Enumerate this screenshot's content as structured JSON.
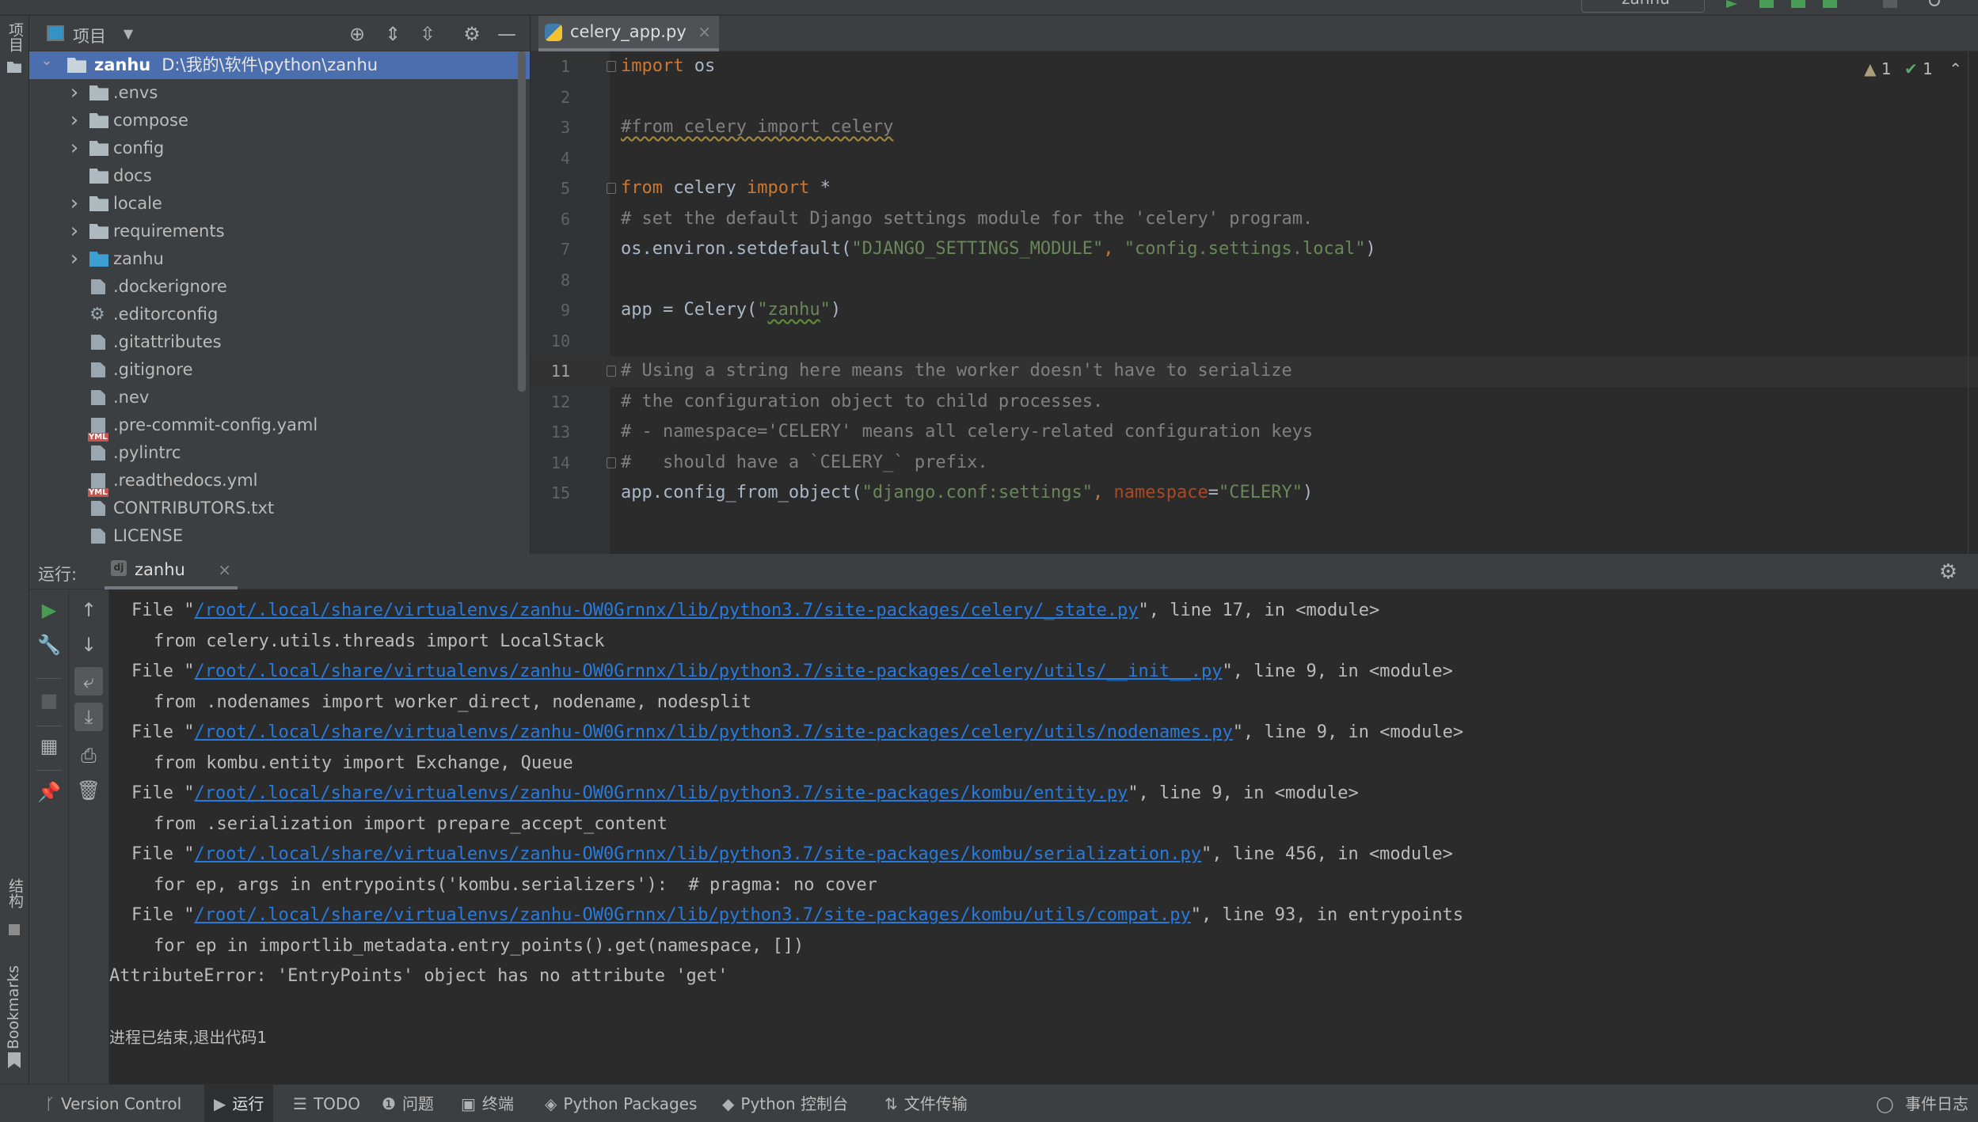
{
  "window": {
    "run_config": "zanhu"
  },
  "left_strip": {
    "project_label": "项目",
    "structure_label": "结构",
    "bookmarks_label": "Bookmarks"
  },
  "project_panel": {
    "title": "项目",
    "icons": [
      "locate-icon",
      "expand-all-icon",
      "collapse-all-icon",
      "gear-icon",
      "minimize-icon"
    ],
    "root": {
      "name": "zanhu",
      "path": "D:\\我的\\软件\\python\\zanhu"
    },
    "items": [
      {
        "name": ".envs",
        "type": "folder",
        "expandable": true
      },
      {
        "name": "compose",
        "type": "folder",
        "expandable": true
      },
      {
        "name": "config",
        "type": "folder-config",
        "expandable": true
      },
      {
        "name": "docs",
        "type": "folder",
        "expandable": false
      },
      {
        "name": "locale",
        "type": "folder",
        "expandable": true
      },
      {
        "name": "requirements",
        "type": "folder",
        "expandable": true
      },
      {
        "name": "zanhu",
        "type": "folder-source",
        "expandable": true
      },
      {
        "name": ".dockerignore",
        "type": "file"
      },
      {
        "name": ".editorconfig",
        "type": "settings-file"
      },
      {
        "name": ".gitattributes",
        "type": "file"
      },
      {
        "name": ".gitignore",
        "type": "ignore-file"
      },
      {
        "name": ".nev",
        "type": "file"
      },
      {
        "name": ".pre-commit-config.yaml",
        "type": "yaml-file"
      },
      {
        "name": ".pylintrc",
        "type": "file"
      },
      {
        "name": ".readthedocs.yml",
        "type": "yaml-file"
      },
      {
        "name": "CONTRIBUTORS.txt",
        "type": "file"
      },
      {
        "name": "LICENSE",
        "type": "file"
      }
    ]
  },
  "editor": {
    "tab": {
      "name": "celery_app.py"
    },
    "inspections": {
      "warnings": "1",
      "weak_warnings": "1"
    },
    "current_line": 11,
    "lines": [
      {
        "n": "1",
        "text": "import os"
      },
      {
        "n": "2",
        "text": ""
      },
      {
        "n": "3",
        "text": "#from celery import celery"
      },
      {
        "n": "4",
        "text": ""
      },
      {
        "n": "5",
        "text": "from celery import *"
      },
      {
        "n": "6",
        "text": "# set the default Django settings module for the 'celery' program."
      },
      {
        "n": "7",
        "text": "os.environ.setdefault(\"DJANGO_SETTINGS_MODULE\", \"config.settings.local\")"
      },
      {
        "n": "8",
        "text": ""
      },
      {
        "n": "9",
        "text": "app = Celery(\"zanhu\")"
      },
      {
        "n": "10",
        "text": ""
      },
      {
        "n": "11",
        "text": "# Using a string here means the worker doesn't have to serialize"
      },
      {
        "n": "12",
        "text": "# the configuration object to child processes."
      },
      {
        "n": "13",
        "text": "# - namespace='CELERY' means all celery-related configuration keys"
      },
      {
        "n": "14",
        "text": "#   should have a `CELERY_` prefix."
      },
      {
        "n": "15",
        "text": "app.config_from_object(\"django.conf:settings\", namespace=\"CELERY\")"
      }
    ]
  },
  "run_panel": {
    "label": "运行:",
    "tab": {
      "name": "zanhu"
    },
    "toolbar": [
      "rerun-icon",
      "wrench-icon",
      "stop-icon",
      "layout-icon",
      "pin-icon",
      "up-icon",
      "down-icon",
      "soft-wrap-icon",
      "scroll-to-end-icon",
      "print-icon",
      "trash-icon"
    ],
    "output": [
      {
        "kind": "file",
        "prefix": "File \"",
        "link": "/root/.local/share/virtualenvs/zanhu-OW0Grnnx/lib/python3.7/site-packages/celery/_state.py",
        "suffix": "\", line 17, in <module>"
      },
      {
        "kind": "code",
        "text": "from celery.utils.threads import LocalStack"
      },
      {
        "kind": "file",
        "prefix": "File \"",
        "link": "/root/.local/share/virtualenvs/zanhu-OW0Grnnx/lib/python3.7/site-packages/celery/utils/__init__.py",
        "suffix": "\", line 9, in <module>"
      },
      {
        "kind": "code",
        "text": "from .nodenames import worker_direct, nodename, nodesplit"
      },
      {
        "kind": "file",
        "prefix": "File \"",
        "link": "/root/.local/share/virtualenvs/zanhu-OW0Grnnx/lib/python3.7/site-packages/celery/utils/nodenames.py",
        "suffix": "\", line 9, in <module>"
      },
      {
        "kind": "code",
        "text": "from kombu.entity import Exchange, Queue"
      },
      {
        "kind": "file",
        "prefix": "File \"",
        "link": "/root/.local/share/virtualenvs/zanhu-OW0Grnnx/lib/python3.7/site-packages/kombu/entity.py",
        "suffix": "\", line 9, in <module>"
      },
      {
        "kind": "code",
        "text": "from .serialization import prepare_accept_content"
      },
      {
        "kind": "file",
        "prefix": "File \"",
        "link": "/root/.local/share/virtualenvs/zanhu-OW0Grnnx/lib/python3.7/site-packages/kombu/serialization.py",
        "suffix": "\", line 456, in <module>"
      },
      {
        "kind": "code",
        "text": "for ep, args in entrypoints('kombu.serializers'):  # pragma: no cover"
      },
      {
        "kind": "file",
        "prefix": "File \"",
        "link": "/root/.local/share/virtualenvs/zanhu-OW0Grnnx/lib/python3.7/site-packages/kombu/utils/compat.py",
        "suffix": "\", line 93, in entrypoints"
      },
      {
        "kind": "code",
        "text": "for ep in importlib_metadata.entry_points().get(namespace, [])"
      },
      {
        "kind": "error",
        "text": "AttributeError: 'EntryPoints' object has no attribute 'get'"
      },
      {
        "kind": "blank",
        "text": ""
      },
      {
        "kind": "exit",
        "text": "进程已结束,退出代码1"
      }
    ]
  },
  "status_bar": {
    "items": [
      {
        "label": "Version Control",
        "icon": "branch-icon",
        "glyph": "ᚴ"
      },
      {
        "label": "运行",
        "icon": "run-icon",
        "glyph": "▶",
        "active": true
      },
      {
        "label": "TODO",
        "icon": "list-icon",
        "glyph": "☰"
      },
      {
        "label": "问题",
        "icon": "problems-icon",
        "glyph": "❶"
      },
      {
        "label": "终端",
        "icon": "terminal-icon",
        "glyph": "▣"
      },
      {
        "label": "Python Packages",
        "icon": "layers-icon",
        "glyph": "◈"
      },
      {
        "label": "Python 控制台",
        "icon": "python-icon",
        "glyph": "◆"
      },
      {
        "label": "文件传输",
        "icon": "transfer-icon",
        "glyph": "⇅"
      }
    ],
    "event_log": "事件日志"
  },
  "colors": {
    "keyword": "#cc7832",
    "comment": "#808080",
    "string": "#6a8759",
    "param": "#aa4926",
    "link": "#287bde",
    "selection": "#4b6eaf",
    "run_green": "#499c54"
  }
}
